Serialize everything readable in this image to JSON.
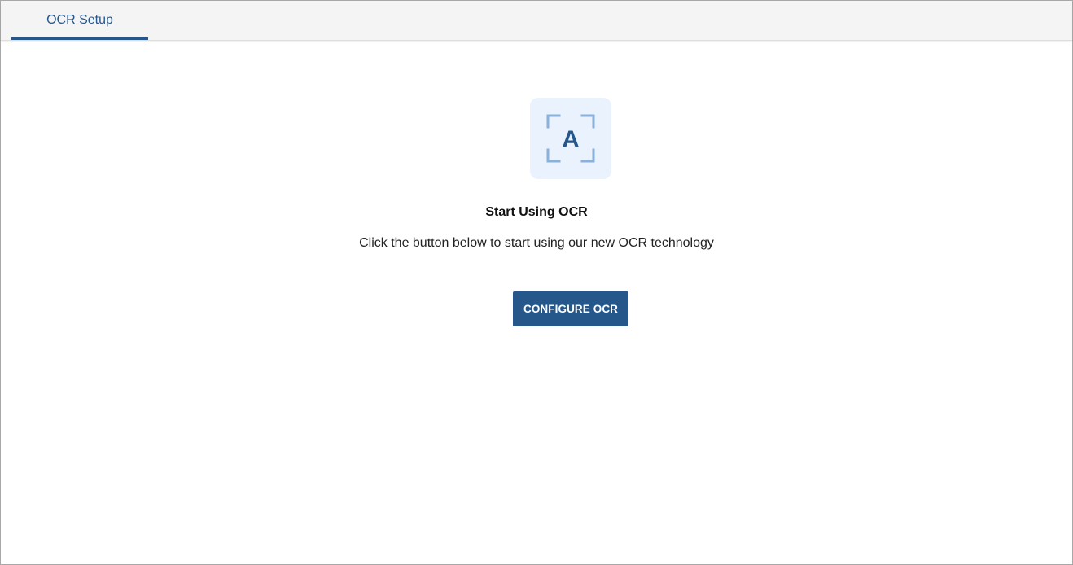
{
  "tabs": [
    {
      "label": "OCR Setup",
      "active": true
    }
  ],
  "empty_state": {
    "icon": "ocr-scan-letter-icon",
    "icon_letter": "A",
    "title": "Start Using OCR",
    "description": "Click the button below to start using our new OCR technology",
    "button_label": "CONFIGURE OCR"
  },
  "colors": {
    "accent": "#25578b",
    "icon_background": "#eaf2fd",
    "icon_corners": "#8ab0dc",
    "tabbar_background": "#f4f4f4"
  }
}
